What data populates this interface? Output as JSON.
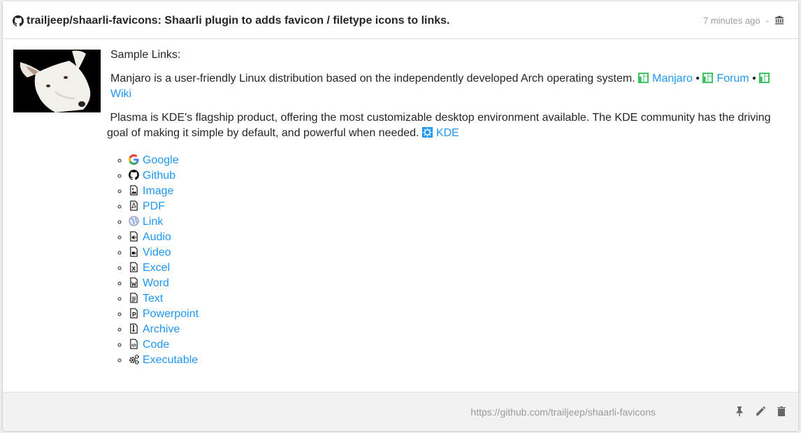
{
  "header": {
    "title": "trailjeep/shaarli-favicons: Shaarli plugin to adds favicon / filetype icons to links.",
    "timestamp": "7 minutes ago",
    "separator": "-"
  },
  "thumbnail": {
    "alt": "dog"
  },
  "description": {
    "heading": "Sample Links:",
    "manjaro_text": "Manjaro is a user-friendly Linux distribution based on the independently developed Arch operating system.",
    "manjaro_links": [
      "Manjaro",
      "Forum",
      "Wiki"
    ],
    "bullet": "•",
    "plasma_text": "Plasma is KDE's flagship product, offering the most customizable desktop environment available. The KDE community has the driving goal of making it simple by default, and powerful when needed.",
    "kde_link": "KDE"
  },
  "list": [
    {
      "label": "Google",
      "icon": "google-icon"
    },
    {
      "label": "Github",
      "icon": "github-icon"
    },
    {
      "label": "Image",
      "icon": "image-file-icon"
    },
    {
      "label": "PDF",
      "icon": "pdf-file-icon"
    },
    {
      "label": "Link",
      "icon": "globe-icon"
    },
    {
      "label": "Audio",
      "icon": "audio-file-icon"
    },
    {
      "label": "Video",
      "icon": "video-file-icon"
    },
    {
      "label": "Excel",
      "icon": "excel-file-icon"
    },
    {
      "label": "Word",
      "icon": "word-file-icon"
    },
    {
      "label": "Text",
      "icon": "text-file-icon"
    },
    {
      "label": "Powerpoint",
      "icon": "powerpoint-file-icon"
    },
    {
      "label": "Archive",
      "icon": "archive-file-icon"
    },
    {
      "label": "Code",
      "icon": "code-file-icon"
    },
    {
      "label": "Executable",
      "icon": "gears-icon"
    }
  ],
  "footer": {
    "url": "https://github.com/trailjeep/shaarli-favicons"
  },
  "colors": {
    "link": "#2196f3",
    "manjaro": "#35bf5c",
    "kde": "#1d99f3"
  }
}
